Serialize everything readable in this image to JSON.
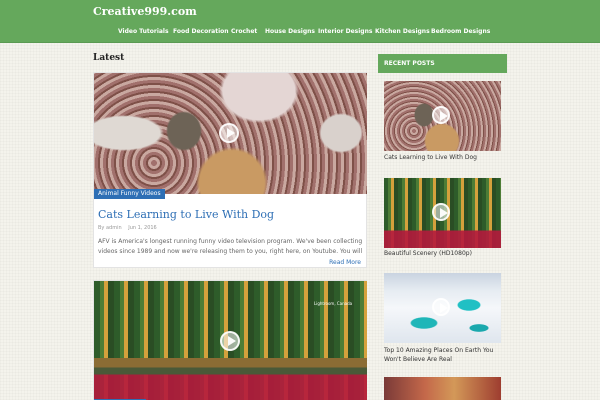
{
  "header": {
    "site_title": "Creative999.com",
    "nav": [
      "Video Tutorials",
      "Food Decoration",
      "Crochet",
      "House Designs",
      "Interior Designs",
      "Kitchen Designs",
      "Bedroom Designs"
    ]
  },
  "main": {
    "section_title": "Latest",
    "posts": [
      {
        "category": "Animal Funny Videos",
        "title": "Cats Learning to Live With Dog",
        "author": "By admin",
        "date": "Jun 1, 2016",
        "excerpt": "AFV is America's longest running funny video television program. We've been collecting videos since 1989 and now we're releasing them to you, right here, on Youtube. You will",
        "read_more": "Read More"
      },
      {
        "image_overlay_text": "Lightroom, Canada"
      }
    ]
  },
  "sidebar": {
    "widget_title": "RECENT POSTS",
    "recent_posts": [
      {
        "title": "Cats Learning to Live With Dog"
      },
      {
        "title": "Beautiful Scenery (HD1080p)"
      },
      {
        "title": "Top 10 Amazing Places On Earth You Won't Believe Are Real"
      }
    ]
  },
  "icons": {
    "play": "play-circle-icon"
  },
  "colors": {
    "header_green": "#65a85c",
    "link_blue": "#2e6fb5",
    "badge_blue": "#2e6fb5"
  }
}
